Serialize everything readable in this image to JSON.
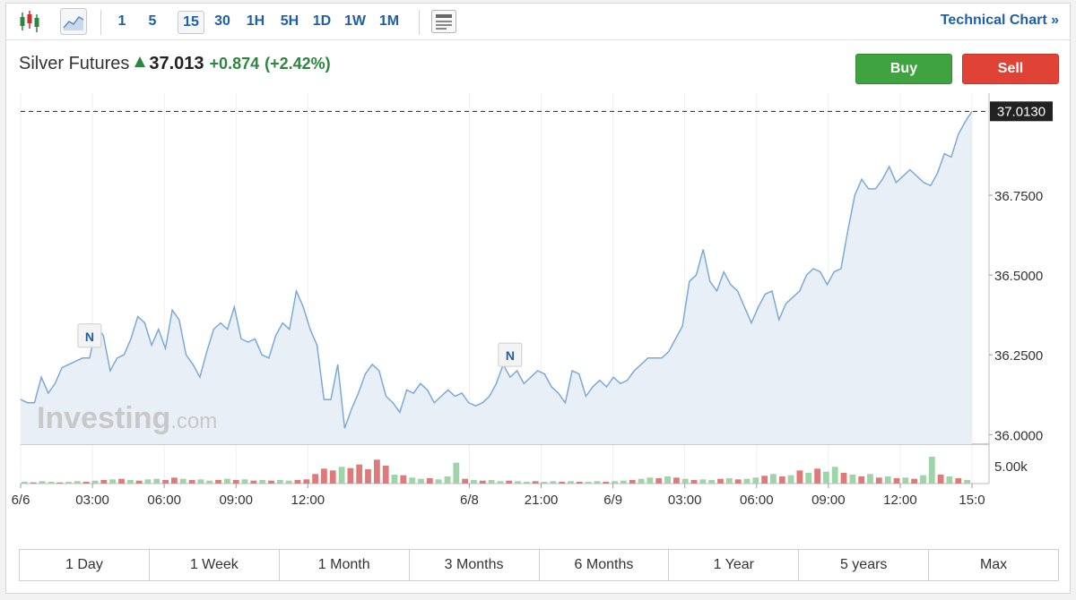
{
  "toolbar": {
    "intervals": [
      "1",
      "5",
      "15",
      "30",
      "1H",
      "5H",
      "1D",
      "1W",
      "1M"
    ],
    "active_interval": "15",
    "technical_chart_label": "Technical Chart »"
  },
  "header": {
    "name": "Silver Futures",
    "price": "37.013",
    "change": "+0.874",
    "change_pct": "(+2.42%)"
  },
  "actions": {
    "buy": "Buy",
    "sell": "Sell"
  },
  "watermark": {
    "brand": "Investing",
    "suffix": ".com"
  },
  "ranges": [
    "1 Day",
    "1 Week",
    "1 Month",
    "3 Months",
    "6 Months",
    "1 Year",
    "5 years",
    "Max"
  ],
  "colors": {
    "line": "#7aaad8",
    "area": "#e9eff7",
    "up_volume": "#9fd4a8",
    "down_volume": "#e07a7a",
    "accent": "#1f5fa8"
  },
  "chart_data": {
    "type": "area",
    "price_label": "37.0130",
    "y_ticks": [
      "37.0130",
      "36.7500",
      "36.5000",
      "36.2500",
      "36.0000"
    ],
    "ylim": [
      35.97,
      37.07
    ],
    "volume_tick": "5.00k",
    "x_ticks": [
      "6/6",
      "03:00",
      "06:00",
      "09:00",
      "12:00",
      "6/8",
      "21:00",
      "6/9",
      "03:00",
      "06:00",
      "09:00",
      "12:00",
      "15:0"
    ],
    "x_tick_positions": [
      0,
      8,
      16,
      24,
      32,
      50,
      58,
      66,
      74,
      82,
      90,
      98,
      106
    ],
    "news_markers": [
      {
        "label": "N",
        "index": 10
      },
      {
        "label": "N",
        "index": 71
      }
    ],
    "series": [
      {
        "values": [
          36.11,
          36.1,
          36.1,
          36.18,
          36.13,
          36.16,
          36.21,
          36.22,
          36.23,
          36.24,
          36.24,
          36.34,
          36.31,
          36.2,
          36.24,
          36.25,
          36.3,
          36.37,
          36.35,
          36.28,
          36.33,
          36.27,
          36.39,
          36.36,
          36.25,
          36.22,
          36.18,
          36.26,
          36.33,
          36.35,
          36.33,
          36.4,
          36.3,
          36.29,
          36.3,
          36.25,
          36.24,
          36.31,
          36.35,
          36.33,
          36.45,
          36.4,
          36.33,
          36.28,
          36.11,
          36.11,
          36.22,
          36.02,
          36.08,
          36.13,
          36.19,
          36.22,
          36.2,
          36.12,
          36.1,
          36.07,
          36.14,
          36.13,
          36.16,
          36.14,
          36.1,
          36.12,
          36.14,
          36.12,
          36.13,
          36.1,
          36.09,
          36.1,
          36.12,
          36.16,
          36.22,
          36.18,
          36.2,
          36.16,
          36.18,
          36.2,
          36.19,
          36.15,
          36.13,
          36.1,
          36.2,
          36.19,
          36.12,
          36.15,
          36.17,
          36.15,
          36.18,
          36.16,
          36.17,
          36.2,
          36.22,
          36.24,
          36.24,
          36.24,
          36.26,
          36.3,
          36.34,
          36.48,
          36.5,
          36.58,
          36.48,
          36.45,
          36.51,
          36.47,
          36.45,
          36.4,
          36.35,
          36.4,
          36.44,
          36.45,
          36.36,
          36.41,
          36.43,
          36.45,
          36.5,
          36.52,
          36.51,
          36.47,
          36.51,
          36.52,
          36.64,
          36.75,
          36.8,
          36.77,
          36.77,
          36.8,
          36.84,
          36.79,
          36.81,
          36.83,
          36.81,
          36.79,
          36.78,
          36.82,
          36.88,
          36.87,
          36.94,
          36.98,
          37.013
        ]
      }
    ],
    "volume": [
      {
        "v": 0.3,
        "up": true
      },
      {
        "v": 0.2,
        "up": false
      },
      {
        "v": 0.4,
        "up": true
      },
      {
        "v": 0.3,
        "up": true
      },
      {
        "v": 0.2,
        "up": false
      },
      {
        "v": 0.3,
        "up": true
      },
      {
        "v": 0.4,
        "up": true
      },
      {
        "v": 0.3,
        "up": false
      },
      {
        "v": 0.5,
        "up": true
      },
      {
        "v": 0.6,
        "up": false
      },
      {
        "v": 0.7,
        "up": true
      },
      {
        "v": 0.8,
        "up": false
      },
      {
        "v": 0.6,
        "up": true
      },
      {
        "v": 0.5,
        "up": false
      },
      {
        "v": 0.7,
        "up": true
      },
      {
        "v": 0.8,
        "up": true
      },
      {
        "v": 0.6,
        "up": false
      },
      {
        "v": 1.0,
        "up": false
      },
      {
        "v": 0.8,
        "up": true
      },
      {
        "v": 0.6,
        "up": false
      },
      {
        "v": 0.7,
        "up": true
      },
      {
        "v": 0.5,
        "up": true
      },
      {
        "v": 0.6,
        "up": false
      },
      {
        "v": 0.8,
        "up": true
      },
      {
        "v": 0.6,
        "up": false
      },
      {
        "v": 0.7,
        "up": true
      },
      {
        "v": 0.5,
        "up": false
      },
      {
        "v": 0.6,
        "up": true
      },
      {
        "v": 0.5,
        "up": false
      },
      {
        "v": 0.6,
        "up": true
      },
      {
        "v": 0.5,
        "up": true
      },
      {
        "v": 0.6,
        "up": false
      },
      {
        "v": 0.7,
        "up": false
      },
      {
        "v": 1.6,
        "up": false
      },
      {
        "v": 2.5,
        "up": false
      },
      {
        "v": 2.2,
        "up": false
      },
      {
        "v": 2.8,
        "up": true
      },
      {
        "v": 2.6,
        "up": false
      },
      {
        "v": 3.2,
        "up": false
      },
      {
        "v": 2.4,
        "up": false
      },
      {
        "v": 4.0,
        "up": false
      },
      {
        "v": 3.0,
        "up": false
      },
      {
        "v": 1.5,
        "up": true
      },
      {
        "v": 1.4,
        "up": false
      },
      {
        "v": 1.0,
        "up": true
      },
      {
        "v": 0.8,
        "up": true
      },
      {
        "v": 0.9,
        "up": false
      },
      {
        "v": 0.7,
        "up": true
      },
      {
        "v": 1.2,
        "up": true
      },
      {
        "v": 3.5,
        "up": true
      },
      {
        "v": 0.8,
        "up": false
      },
      {
        "v": 0.6,
        "up": true
      },
      {
        "v": 0.5,
        "up": false
      },
      {
        "v": 0.6,
        "up": true
      },
      {
        "v": 0.4,
        "up": true
      },
      {
        "v": 0.5,
        "up": false
      },
      {
        "v": 0.4,
        "up": true
      },
      {
        "v": 0.3,
        "up": true
      },
      {
        "v": 0.4,
        "up": false
      },
      {
        "v": 0.3,
        "up": true
      },
      {
        "v": 0.4,
        "up": true
      },
      {
        "v": 0.3,
        "up": false
      },
      {
        "v": 0.4,
        "up": true
      },
      {
        "v": 0.3,
        "up": false
      },
      {
        "v": 0.3,
        "up": true
      },
      {
        "v": 0.4,
        "up": true
      },
      {
        "v": 0.3,
        "up": false
      },
      {
        "v": 0.4,
        "up": true
      },
      {
        "v": 0.5,
        "up": true
      },
      {
        "v": 0.6,
        "up": false
      },
      {
        "v": 0.8,
        "up": true
      },
      {
        "v": 1.0,
        "up": true
      },
      {
        "v": 0.9,
        "up": false
      },
      {
        "v": 1.2,
        "up": true
      },
      {
        "v": 1.0,
        "up": false
      },
      {
        "v": 0.8,
        "up": true
      },
      {
        "v": 0.6,
        "up": false
      },
      {
        "v": 0.7,
        "up": true
      },
      {
        "v": 0.6,
        "up": true
      },
      {
        "v": 0.8,
        "up": false
      },
      {
        "v": 0.9,
        "up": true
      },
      {
        "v": 0.7,
        "up": false
      },
      {
        "v": 0.8,
        "up": true
      },
      {
        "v": 1.0,
        "up": true
      },
      {
        "v": 1.3,
        "up": false
      },
      {
        "v": 1.6,
        "up": true
      },
      {
        "v": 1.2,
        "up": false
      },
      {
        "v": 1.4,
        "up": true
      },
      {
        "v": 2.2,
        "up": false
      },
      {
        "v": 1.8,
        "up": true
      },
      {
        "v": 2.5,
        "up": false
      },
      {
        "v": 2.0,
        "up": true
      },
      {
        "v": 2.8,
        "up": true
      },
      {
        "v": 1.8,
        "up": false
      },
      {
        "v": 1.5,
        "up": true
      },
      {
        "v": 1.2,
        "up": false
      },
      {
        "v": 1.6,
        "up": true
      },
      {
        "v": 1.0,
        "up": false
      },
      {
        "v": 1.2,
        "up": true
      },
      {
        "v": 0.9,
        "up": false
      },
      {
        "v": 1.0,
        "up": true
      },
      {
        "v": 0.8,
        "up": false
      },
      {
        "v": 1.4,
        "up": true
      },
      {
        "v": 4.5,
        "up": true
      },
      {
        "v": 1.5,
        "up": false
      },
      {
        "v": 1.2,
        "up": true
      },
      {
        "v": 0.9,
        "up": false
      },
      {
        "v": 0.6,
        "up": true
      }
    ]
  }
}
